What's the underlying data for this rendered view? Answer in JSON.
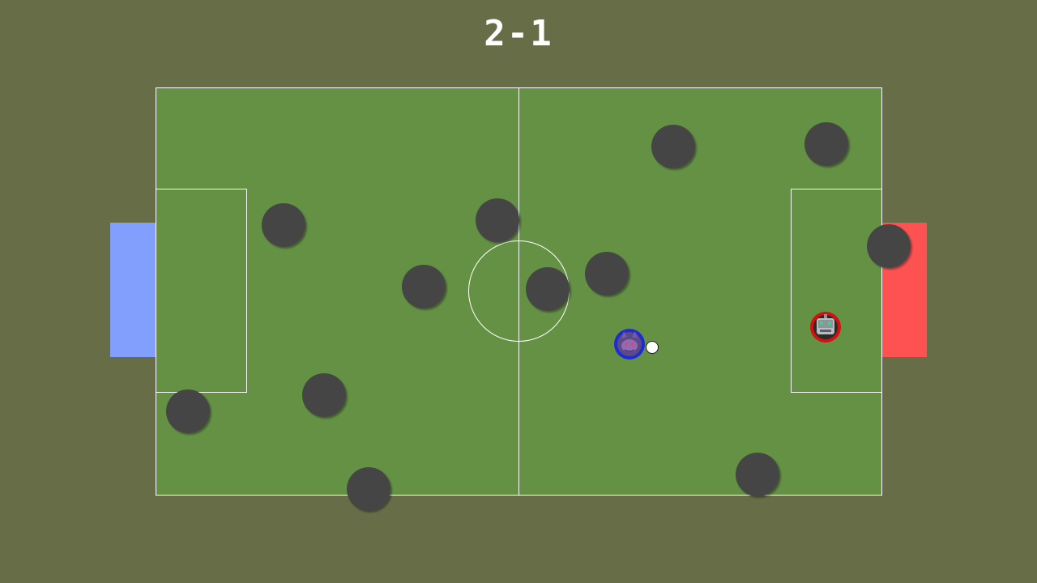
{
  "score": {
    "home": "2",
    "separator": "-",
    "away": "1"
  },
  "colors": {
    "background": "#676e47",
    "pitch": "#659145",
    "lines": "#ffffff",
    "home_goal": "#829ffe",
    "away_goal": "#fe5252",
    "obstacle": "#444444",
    "home_player_ring": "#1d2bd6",
    "away_player_ring": "#d60f0f",
    "ball": "#ffffff"
  },
  "sprites": {
    "home_player": "cat-face-avatar",
    "away_player": "robot-face-avatar",
    "obstacles": "dark-round-rock"
  }
}
